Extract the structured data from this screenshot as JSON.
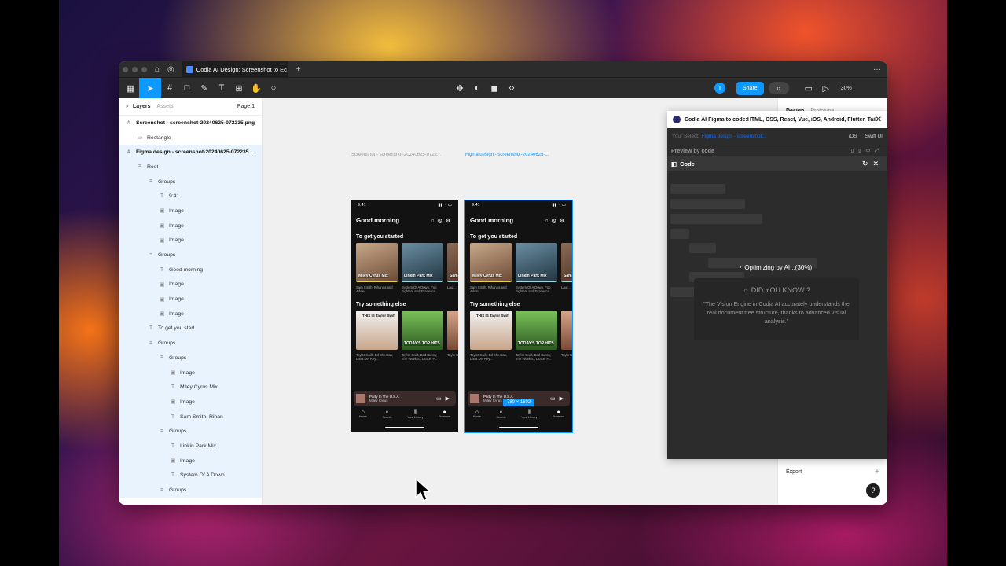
{
  "tab": {
    "title": "Codia AI Design: Screenshot to Ec",
    "new_tab": "+"
  },
  "toolbar": {
    "share_label": "Share",
    "avatar_initial": "T",
    "zoom": "30%"
  },
  "layers_panel": {
    "tabs": [
      "Layers",
      "Assets"
    ],
    "page": "Page 1",
    "rows": [
      {
        "label": "Screenshot - screenshot-20240625-072235.png",
        "icon": "hash-icon",
        "depth": 0,
        "bold": true
      },
      {
        "label": "Rectangle",
        "icon": "rect-icon",
        "depth": 1
      },
      {
        "label": "Figma design - screenshot-20240625-072235...",
        "icon": "hash-icon",
        "depth": 0,
        "bold": true,
        "highlight": true
      },
      {
        "label": "Root",
        "icon": "frame-icon",
        "depth": 1,
        "highlight": true
      },
      {
        "label": "Groups",
        "icon": "frame-icon",
        "depth": 2,
        "highlight": true
      },
      {
        "label": "9:41",
        "icon": "text-icon",
        "depth": 3,
        "highlight": true
      },
      {
        "label": "Image",
        "icon": "image-icon",
        "depth": 3,
        "highlight": true
      },
      {
        "label": "Image",
        "icon": "image-icon",
        "depth": 3,
        "highlight": true
      },
      {
        "label": "Image",
        "icon": "image-icon",
        "depth": 3,
        "highlight": true
      },
      {
        "label": "Groups",
        "icon": "frame-icon",
        "depth": 2,
        "highlight": true
      },
      {
        "label": "Good morning",
        "icon": "text-icon",
        "depth": 3,
        "highlight": true
      },
      {
        "label": "Image",
        "icon": "image-icon",
        "depth": 3,
        "highlight": true
      },
      {
        "label": "Image",
        "icon": "image-icon",
        "depth": 3,
        "highlight": true
      },
      {
        "label": "Image",
        "icon": "image-icon",
        "depth": 3,
        "highlight": true
      },
      {
        "label": "To get you start",
        "icon": "text-icon",
        "depth": 2,
        "highlight": true
      },
      {
        "label": "Groups",
        "icon": "frame-icon",
        "depth": 2,
        "highlight": true
      },
      {
        "label": "Groups",
        "icon": "frame-icon",
        "depth": 3,
        "highlight": true
      },
      {
        "label": "Image",
        "icon": "image-icon",
        "depth": 4,
        "highlight": true
      },
      {
        "label": "Miley Cyrus Mix",
        "icon": "text-icon",
        "depth": 4,
        "highlight": true
      },
      {
        "label": "Image",
        "icon": "image-icon",
        "depth": 4,
        "highlight": true
      },
      {
        "label": "Sam Smith, Rihan",
        "icon": "text-icon",
        "depth": 4,
        "highlight": true
      },
      {
        "label": "Groups",
        "icon": "frame-icon",
        "depth": 3,
        "highlight": true
      },
      {
        "label": "Linkin Park Mix",
        "icon": "text-icon",
        "depth": 4,
        "highlight": true
      },
      {
        "label": "Image",
        "icon": "image-icon",
        "depth": 4,
        "highlight": true
      },
      {
        "label": "System Of A Down",
        "icon": "text-icon",
        "depth": 4,
        "highlight": true
      },
      {
        "label": "Groups",
        "icon": "frame-icon",
        "depth": 3,
        "highlight": true
      }
    ]
  },
  "canvas": {
    "frame1_label": "Screenshot - screenshot-20240625-0722...",
    "frame2_label": "Figma design - screenshot-20240625-...",
    "size_badge": "780 × 1692",
    "phone": {
      "time": "9:41",
      "greeting": "Good morning",
      "section1": "To get you started",
      "section2": "Try something else",
      "cards1": [
        {
          "title": "Miley Cyrus Mix",
          "sub": "Sam Smith, Rihanna and Adele"
        },
        {
          "title": "Linkin Park Mix",
          "sub": "System Of A Down, Foo Fighters and Evanesce..."
        },
        {
          "title": "Sam",
          "sub": "Laur..."
        }
      ],
      "cards2": [
        {
          "title": "THIS IS Taylor Swift",
          "sub": "Taylor Swift, Ed Sheeran, Lana Del Rey..."
        },
        {
          "title": "TODAY'S TOP HITS",
          "sub": "Taylor Swift, Bad Bunny, The Weeknd, Drake, P..."
        },
        {
          "title": "",
          "sub": "Taylo Weekr..."
        }
      ],
      "now_playing_title": "Party In The U.S.A.",
      "now_playing_artist": "Miley Cyrus",
      "nav": [
        "Home",
        "Search",
        "Your Library",
        "Premium"
      ]
    }
  },
  "right_panel": {
    "tabs": [
      "Design",
      "Prototype"
    ],
    "export_label": "Export",
    "help": "?"
  },
  "plugin": {
    "title": "Codia AI Figma to code:HTML, CSS, React, Vue, iOS, Android, Flutter, Tailw...",
    "your_select_label": "Your Select:",
    "your_select_value": "Figma design - screenshot...",
    "platform": "iOS",
    "framework": "Swift UI",
    "preview_label": "Preview by code",
    "code_label": "Code",
    "progress_text": "Optimizing by AI...(30%)",
    "did_you_know_title": "DID YOU KNOW ?",
    "did_you_know_body": "\"The Vision Engine in Codia AI accurately understands the real document tree structure, thanks to advanced visual analysis.\""
  }
}
